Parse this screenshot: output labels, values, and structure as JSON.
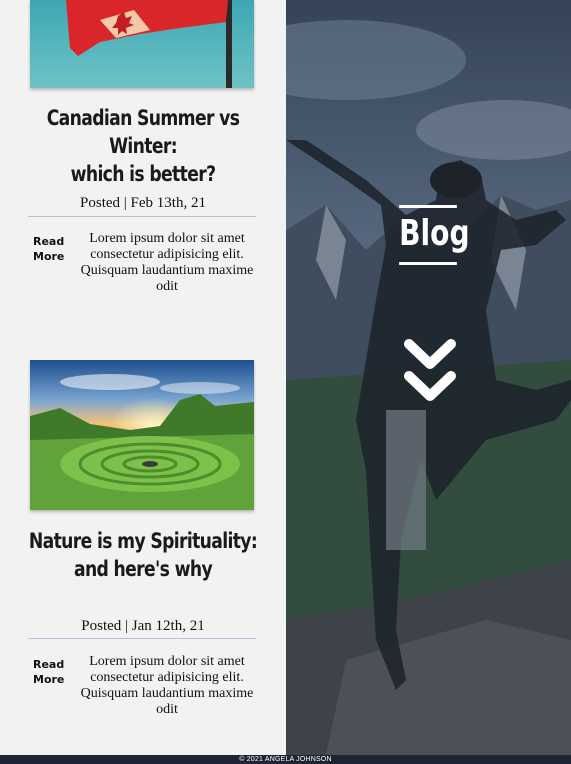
{
  "posts": [
    {
      "title_line1": "Canadian Summer vs Winter:",
      "title_line2": "which is better?",
      "posted": "Posted | Feb 13th, 21",
      "read_more_line1": "Read",
      "read_more_line2": "More",
      "excerpt": "Lorem ipsum dolor sit amet consectetur adipisicing elit. Quisquam laudantium maxime odit"
    },
    {
      "title_line1": "Nature is my Spirituality:",
      "title_line2": "and here's why",
      "posted": "Posted | Jan 12th, 21",
      "read_more_line1": "Read",
      "read_more_line2": "More",
      "excerpt": "Lorem ipsum dolor sit amet consectetur adipisicing elit. Quisquam laudantium maxime odit"
    }
  ],
  "hero": {
    "heading": "Blog",
    "scroll_icon": "double-chevron-down-icon"
  },
  "footer": {
    "copyright": "© 2021 ANGELA JOHNSON"
  },
  "colors": {
    "footer_bg": "#1e2433",
    "rule": "#b9bfd6",
    "page_bg": "#f2f2f2"
  }
}
